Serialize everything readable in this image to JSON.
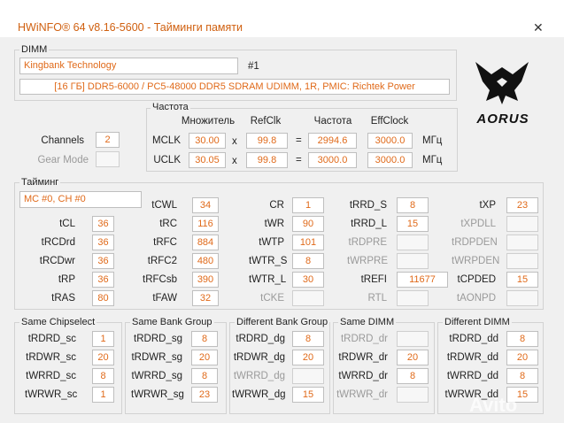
{
  "window": {
    "title": "HWiNFO® 64 v8.16-5600 - Тайминги памяти",
    "close_glyph": "✕"
  },
  "dimm": {
    "legend": "DIMM",
    "manufacturer": "Kingbank Technology",
    "slot": "#1",
    "description": "[16 ГБ] DDR5-6000 / PC5-48000 DDR5 SDRAM UDIMM, 1R, PMIC: Richtek Power"
  },
  "brand": {
    "logo_text": "AORUS"
  },
  "frequency": {
    "legend": "Частота",
    "headers": {
      "multiplier": "Множитель",
      "refclk": "RefClk",
      "freq": "Частота",
      "effclock": "EffClock"
    },
    "rows": [
      {
        "label": "MCLK",
        "mult": "30.00",
        "op1": "x",
        "refclk": "99.8",
        "op2": "=",
        "freq": "2994.6",
        "eff": "3000.0",
        "unit": "МГц"
      },
      {
        "label": "UCLK",
        "mult": "30.05",
        "op1": "x",
        "refclk": "99.8",
        "op2": "=",
        "freq": "3000.0",
        "eff": "3000.0",
        "unit": "МГц"
      }
    ]
  },
  "channels": {
    "label": "Channels",
    "value": "2"
  },
  "gear_mode": {
    "label": "Gear Mode",
    "value": ""
  },
  "timings": {
    "legend": "Тайминг",
    "mc_select": "MC #0, CH #0",
    "row0": [
      {
        "label": "tCWL",
        "value": "34"
      },
      {
        "label": "CR",
        "value": "1"
      },
      {
        "label": "tRRD_S",
        "value": "8"
      },
      {
        "label": "tXP",
        "value": "23"
      }
    ],
    "cols": [
      [
        {
          "label": "tCL",
          "value": "36"
        },
        {
          "label": "tRCDrd",
          "value": "36"
        },
        {
          "label": "tRCDwr",
          "value": "36"
        },
        {
          "label": "tRP",
          "value": "36"
        },
        {
          "label": "tRAS",
          "value": "80"
        }
      ],
      [
        {
          "label": "tRC",
          "value": "116"
        },
        {
          "label": "tRFC",
          "value": "884"
        },
        {
          "label": "tRFC2",
          "value": "480"
        },
        {
          "label": "tRFCsb",
          "value": "390"
        },
        {
          "label": "tFAW",
          "value": "32"
        }
      ],
      [
        {
          "label": "tWR",
          "value": "90"
        },
        {
          "label": "tWTP",
          "value": "101"
        },
        {
          "label": "tWTR_S",
          "value": "8"
        },
        {
          "label": "tWTR_L",
          "value": "30"
        },
        {
          "label": "tCKE",
          "value": "",
          "disabled": true
        }
      ],
      [
        {
          "label": "tRRD_L",
          "value": "15"
        },
        {
          "label": "tRDPRE",
          "value": "",
          "disabled": true
        },
        {
          "label": "tWRPRE",
          "value": "",
          "disabled": true
        },
        {
          "label": "tREFI",
          "value": "11677"
        },
        {
          "label": "RTL",
          "value": "",
          "disabled": true
        }
      ],
      [
        {
          "label": "tXPDLL",
          "value": "",
          "disabled": true
        },
        {
          "label": "tRDPDEN",
          "value": "",
          "disabled": true
        },
        {
          "label": "tWRPDEN",
          "value": "",
          "disabled": true
        },
        {
          "label": "tCPDED",
          "value": "15"
        },
        {
          "label": "tAONPD",
          "value": "",
          "disabled": true
        }
      ]
    ]
  },
  "turnaround": [
    {
      "title": "Same Chipselect",
      "rows": [
        {
          "label": "tRDRD_sc",
          "value": "1"
        },
        {
          "label": "tRDWR_sc",
          "value": "20"
        },
        {
          "label": "tWRRD_sc",
          "value": "8"
        },
        {
          "label": "tWRWR_sc",
          "value": "1"
        }
      ]
    },
    {
      "title": "Same Bank Group",
      "rows": [
        {
          "label": "tRDRD_sg",
          "value": "8"
        },
        {
          "label": "tRDWR_sg",
          "value": "20"
        },
        {
          "label": "tWRRD_sg",
          "value": "8"
        },
        {
          "label": "tWRWR_sg",
          "value": "23"
        }
      ]
    },
    {
      "title": "Different Bank Group",
      "rows": [
        {
          "label": "tRDRD_dg",
          "value": "8"
        },
        {
          "label": "tRDWR_dg",
          "value": "20"
        },
        {
          "label": "tWRRD_dg",
          "value": "",
          "disabled": true
        },
        {
          "label": "tWRWR_dg",
          "value": "15"
        }
      ]
    },
    {
      "title": "Same DIMM",
      "rows": [
        {
          "label": "tRDRD_dr",
          "value": "",
          "disabled": true
        },
        {
          "label": "tRDWR_dr",
          "value": "20"
        },
        {
          "label": "tWRRD_dr",
          "value": "8"
        },
        {
          "label": "tWRWR_dr",
          "value": "",
          "disabled": true
        }
      ]
    },
    {
      "title": "Different DIMM",
      "rows": [
        {
          "label": "tRDRD_dd",
          "value": "8"
        },
        {
          "label": "tRDWR_dd",
          "value": "20"
        },
        {
          "label": "tWRRD_dd",
          "value": "8"
        },
        {
          "label": "tWRWR_dd",
          "value": "15"
        }
      ]
    }
  ],
  "watermark": {
    "text": "Avito"
  },
  "colors": {
    "accent": "#e06a1a",
    "title": "#d06010"
  }
}
